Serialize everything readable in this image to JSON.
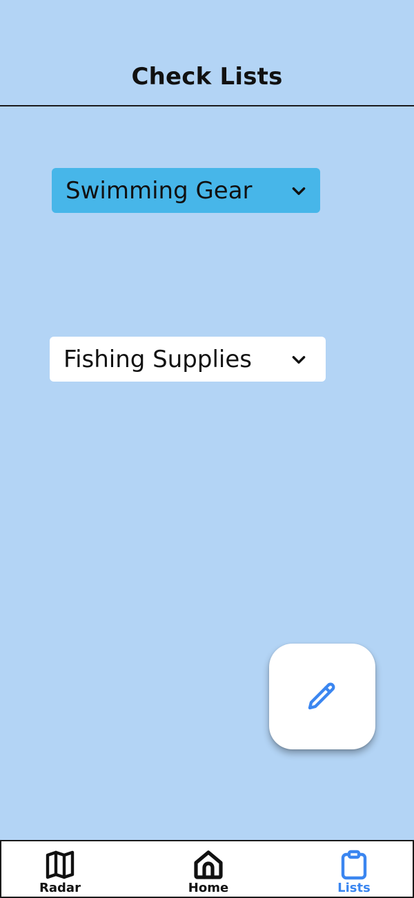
{
  "header": {
    "title": "Check Lists"
  },
  "lists": [
    {
      "label": "Swimming Gear",
      "icon": "chevron-down-icon",
      "background": "#47b6e9"
    },
    {
      "label": "Fishing Supplies",
      "icon": "chevron-down-icon",
      "background": "#ffffff"
    }
  ],
  "fab": {
    "icon": "pencil-icon",
    "icon_color": "#3b86f0"
  },
  "bottom_nav": {
    "items": [
      {
        "label": "Radar",
        "icon": "map-icon",
        "active": false
      },
      {
        "label": "Home",
        "icon": "home-icon",
        "active": false
      },
      {
        "label": "Lists",
        "icon": "clipboard-icon",
        "active": true
      }
    ]
  },
  "colors": {
    "background": "#b3d4f5",
    "accent": "#3b86f0",
    "selected_list": "#47b6e9"
  }
}
